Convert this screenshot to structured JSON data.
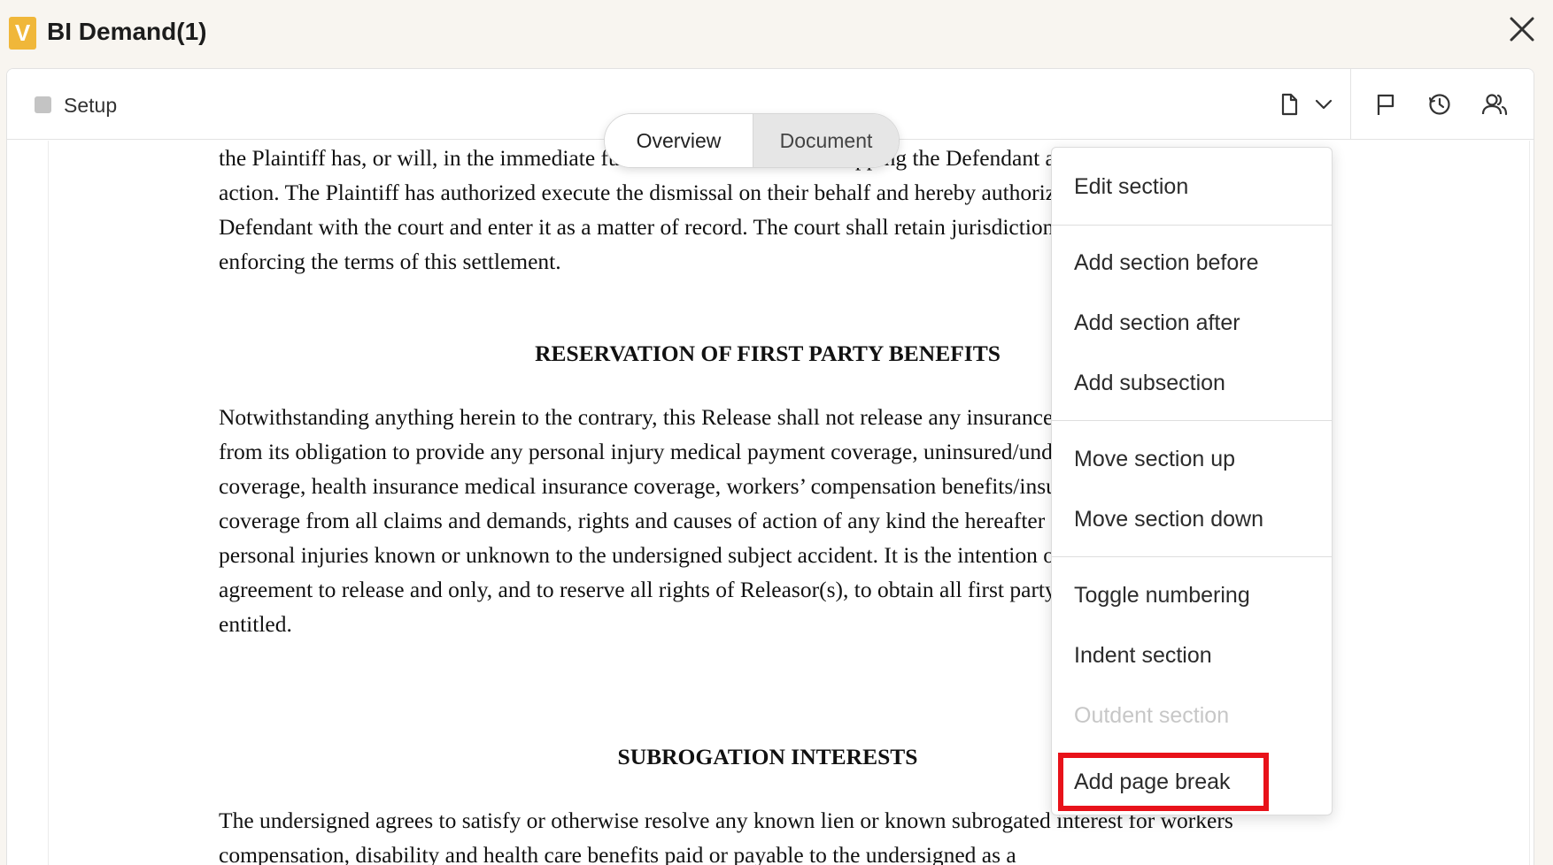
{
  "app": {
    "logo_letter": "V",
    "title": "BI Demand(1)",
    "accent_color": "#f0b73a"
  },
  "header": {
    "setup_label": "Setup",
    "icons": [
      "document-icon",
      "chevron-down-icon",
      "flag-icon",
      "history-icon",
      "users-icon"
    ]
  },
  "view_toggle": {
    "tabs": [
      {
        "label": "Overview",
        "active": false
      },
      {
        "label": "Document",
        "active": true
      }
    ]
  },
  "document": {
    "para1": "the Plaintiff has, or will, in the immediate future for the Defendant dropping the Defendant as a party to the pending action. The Plaintiff has authorized execute the dismissal on their behalf and hereby authorizes counsel for the Defendant with the court and enter it as a matter of record. The court shall retain jurisdiction parties and for enforcing the terms of this settlement.",
    "heading1": "RESERVATION OF FIRST PARTY BENEFITS",
    "para2": "Notwithstanding anything herein to the contrary, this Release shall not release any insurance carrier or self-insureds from its obligation to provide any personal injury medical payment coverage, uninsured/underinsured motorist coverage, health insurance medical insurance coverage, workers’ compensation benefits/insurance, and/or disability coverage from all claims and demands, rights and causes of action of any kind the hereafter may have, on account of personal injuries known or unknown to the undersigned subject accident. It is the intention of the parties to this agreement to release and only, and to reserve all rights of Releasor(s), to obtain all first party benefits to which entitled.",
    "heading2": "SUBROGATION INTERESTS",
    "para3": "The undersigned agrees to satisfy or otherwise resolve any known lien or known subrogated interest for workers compensation, disability and health care benefits paid or payable to the undersigned as a"
  },
  "context_menu": {
    "edit_section": "Edit section",
    "add_section_before": "Add section before",
    "add_section_after": "Add section after",
    "add_subsection": "Add subsection",
    "move_section_up": "Move section up",
    "move_section_down": "Move section down",
    "toggle_numbering": "Toggle numbering",
    "indent_section": "Indent section",
    "outdent_section": "Outdent section",
    "add_page_break": "Add page break",
    "highlight_color": "#e8121a"
  }
}
